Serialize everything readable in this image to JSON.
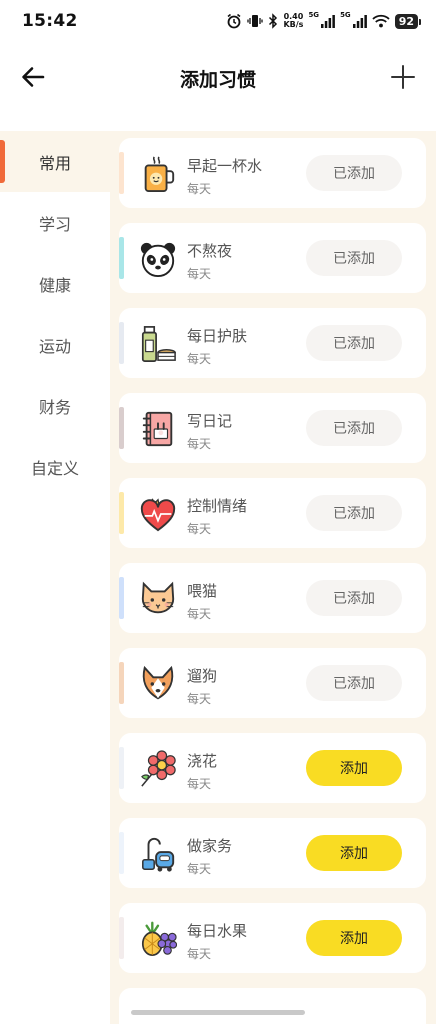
{
  "status": {
    "time": "15:42",
    "speed_value": "0.40",
    "speed_unit": "KB/s",
    "net1": "5G",
    "net2": "5G",
    "battery": "92"
  },
  "header": {
    "title": "添加习惯"
  },
  "sidebar": {
    "items": [
      "常用",
      "学习",
      "健康",
      "运动",
      "财务",
      "自定义"
    ]
  },
  "habits": [
    {
      "name": "早起一杯水",
      "freq": "每天",
      "button": "已添加",
      "added": true,
      "accent": "#fde4cf",
      "icon": "cup-icon"
    },
    {
      "name": "不熬夜",
      "freq": "每天",
      "button": "已添加",
      "added": true,
      "accent": "#a9e6e8",
      "icon": "panda-icon"
    },
    {
      "name": "每日护肤",
      "freq": "每天",
      "button": "已添加",
      "added": true,
      "accent": "#e6eaf1",
      "icon": "skincare-icon"
    },
    {
      "name": "写日记",
      "freq": "每天",
      "button": "已添加",
      "added": true,
      "accent": "#d9cdcd",
      "icon": "diary-icon"
    },
    {
      "name": "控制情绪",
      "freq": "每天",
      "button": "已添加",
      "added": true,
      "accent": "#fde9a9",
      "icon": "heart-icon"
    },
    {
      "name": "喂猫",
      "freq": "每天",
      "button": "已添加",
      "added": true,
      "accent": "#cfe0fb",
      "icon": "cat-icon"
    },
    {
      "name": "遛狗",
      "freq": "每天",
      "button": "已添加",
      "added": true,
      "accent": "#f5d5bb",
      "icon": "dog-icon"
    },
    {
      "name": "浇花",
      "freq": "每天",
      "button": "添加",
      "added": false,
      "accent": "#eef1f6",
      "icon": "flower-icon"
    },
    {
      "name": "做家务",
      "freq": "每天",
      "button": "添加",
      "added": false,
      "accent": "#edf3fb",
      "icon": "vacuum-icon"
    },
    {
      "name": "每日水果",
      "freq": "每天",
      "button": "添加",
      "added": false,
      "accent": "#f3ecec",
      "icon": "fruit-icon"
    }
  ],
  "colors": {
    "active_indicator": "#f06a3a",
    "add_button": "#f9dc23",
    "content_bg": "#fbf5ea"
  }
}
